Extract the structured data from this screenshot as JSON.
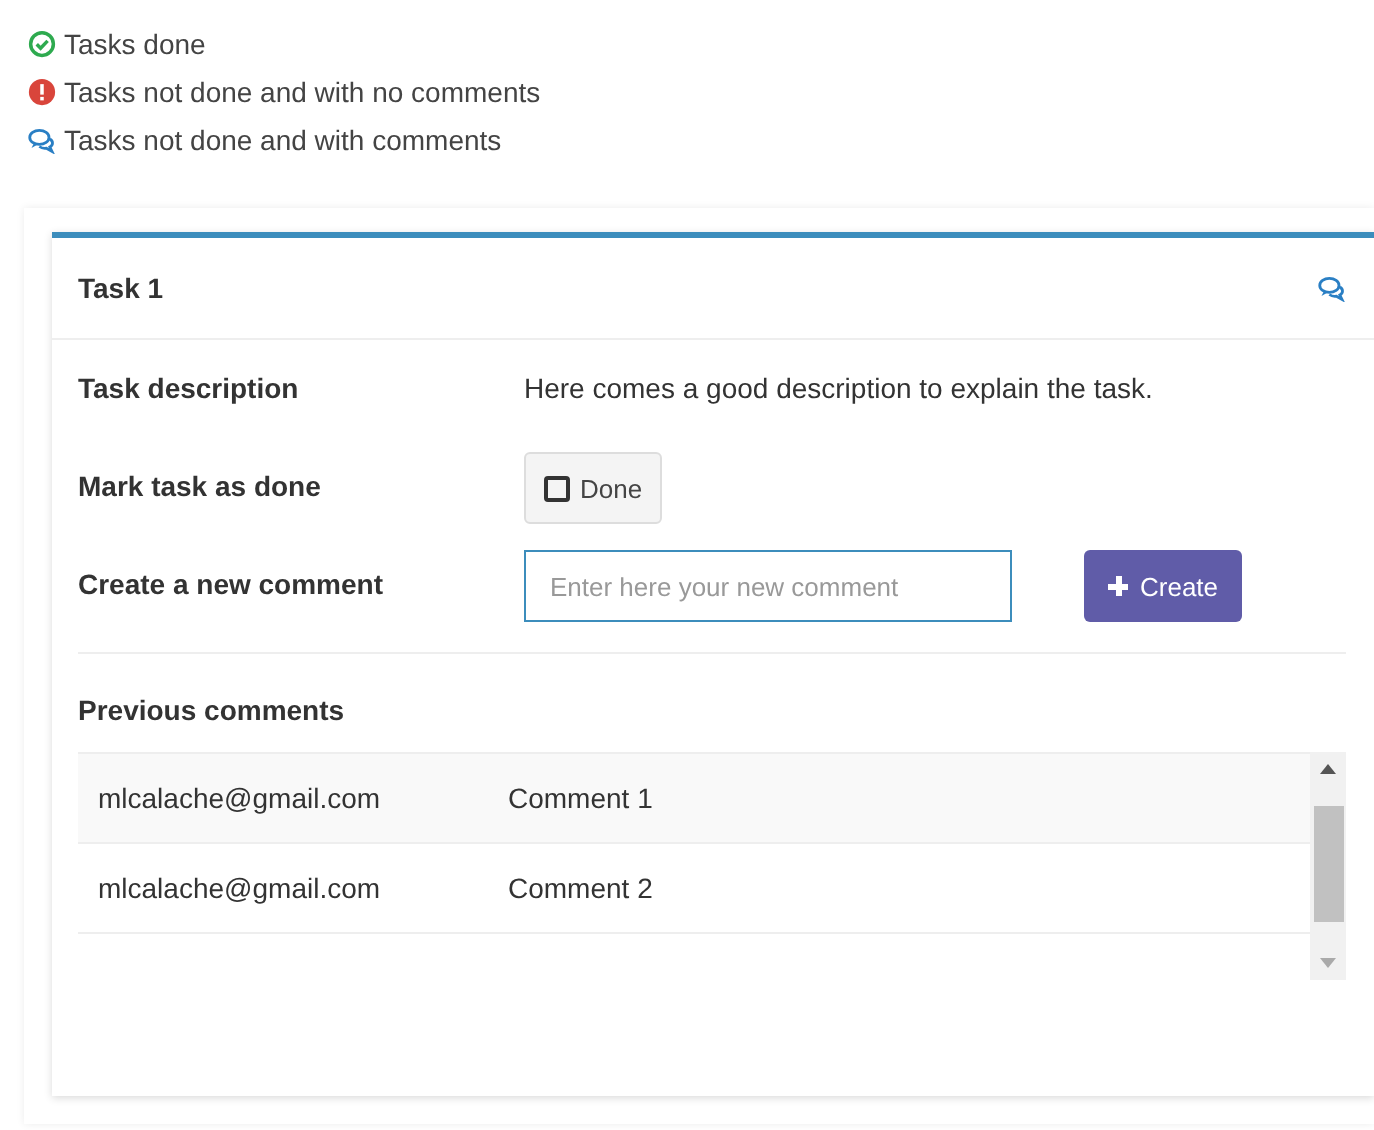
{
  "legend": [
    {
      "kind": "done",
      "label": "Tasks done"
    },
    {
      "kind": "not_done",
      "label": "Tasks not done and with no comments"
    },
    {
      "kind": "commented",
      "label": "Tasks not done and with comments"
    }
  ],
  "task": {
    "title": "Task 1",
    "kind": "commented",
    "description_label": "Task description",
    "description": "Here comes a good description to explain the task.",
    "mark_label": "Mark task as done",
    "done_button": {
      "label": "Done",
      "checked": false
    },
    "comment_label": "Create a new comment",
    "comment_field": {
      "placeholder": "Enter here your new comment"
    },
    "create_button": "Create",
    "previous_label": "Previous comments",
    "comments": [
      {
        "author": "mlcalache@gmail.com",
        "text": "Comment 1"
      },
      {
        "author": "mlcalache@gmail.com",
        "text": "Comment 2"
      }
    ]
  }
}
